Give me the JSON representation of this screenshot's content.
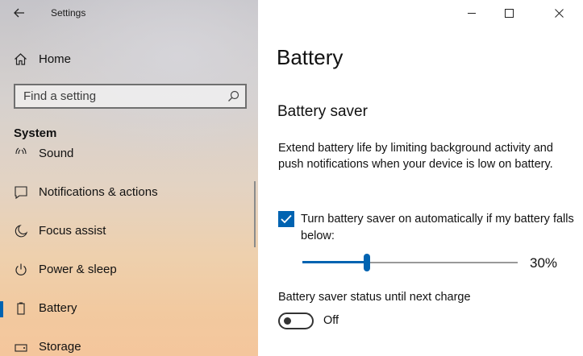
{
  "window": {
    "title": "Settings"
  },
  "nav": {
    "home_label": "Home",
    "search": {
      "placeholder": "Find a setting",
      "value": ""
    },
    "section_title": "System",
    "items": [
      {
        "label": "Sound",
        "icon": "speaker-icon",
        "selected": false
      },
      {
        "label": "Notifications & actions",
        "icon": "notifications-icon",
        "selected": false
      },
      {
        "label": "Focus assist",
        "icon": "moon-icon",
        "selected": false
      },
      {
        "label": "Power & sleep",
        "icon": "power-icon",
        "selected": false
      },
      {
        "label": "Battery",
        "icon": "battery-icon",
        "selected": true
      },
      {
        "label": "Storage",
        "icon": "storage-icon",
        "selected": false
      }
    ]
  },
  "content": {
    "page_title": "Battery",
    "section_title": "Battery saver",
    "description": "Extend battery life by limiting background activity and push notifications when your device is low on battery.",
    "auto_checkbox": {
      "label": "Turn battery saver on automatically if my battery falls below:",
      "checked": true
    },
    "threshold_slider": {
      "value": 30,
      "min": 0,
      "max": 100,
      "display": "30%"
    },
    "status": {
      "label": "Battery saver status until next charge",
      "toggle_on": false,
      "toggle_text": "Off"
    }
  },
  "colors": {
    "accent": "#0063b1",
    "text": "#111111",
    "content_bg": "#ffffff"
  }
}
